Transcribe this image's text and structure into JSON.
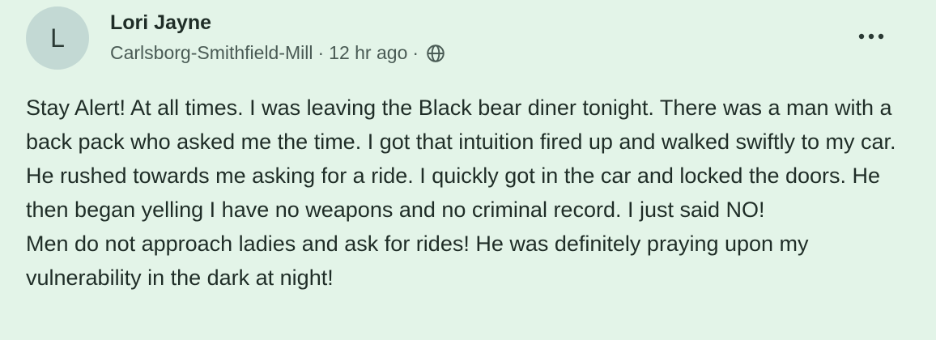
{
  "author": {
    "avatar_initial": "L",
    "name": "Lori Jayne",
    "neighborhood": "Carlsborg-Smithfield-Mill",
    "separator": "·",
    "timestamp": "12 hr ago",
    "visibility_icon": "globe-icon"
  },
  "menu": {
    "icon": "more-options-icon"
  },
  "post": {
    "paragraph_1": "Stay Alert! At all times. I was leaving the Black bear diner tonight. There was a man with a back pack who asked me the time. I got that intuition fired up and walked swiftly to my car. He rushed towards me asking for a ride. I quickly got in the car and locked the doors. He then began yelling I have no weapons and no criminal record. I just said NO!",
    "paragraph_2": "Men do not approach ladies and ask for rides! He was definitely praying upon my vulnerability in the dark at night!"
  },
  "colors": {
    "background": "#e3f4e8",
    "avatar_bg": "#c3d9d4",
    "text": "#1f2d27",
    "meta_text": "#4a5b55"
  }
}
